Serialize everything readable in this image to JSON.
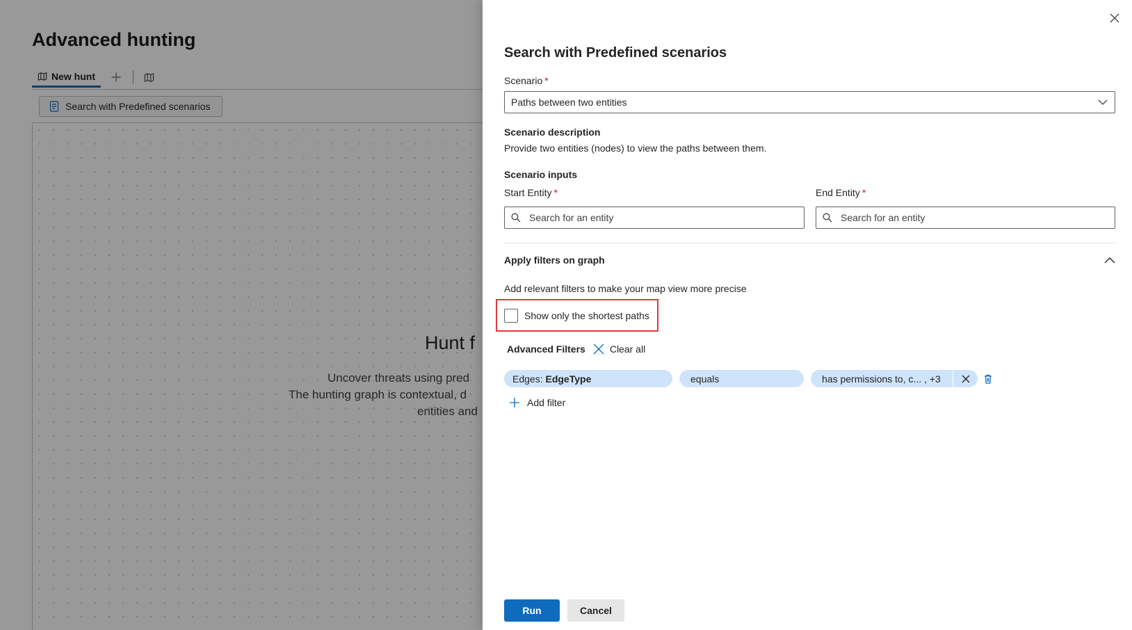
{
  "background": {
    "page_title": "Advanced hunting",
    "tabs": [
      {
        "label": "New hunt"
      }
    ],
    "toolbar": {
      "predefined_button": "Search with Predefined scenarios"
    },
    "empty_state": {
      "title": "Hunt f",
      "lines": [
        "Uncover threats using pred",
        "The hunting graph is contextual, d",
        "entities and"
      ]
    }
  },
  "panel": {
    "title": "Search with Predefined scenarios",
    "scenario": {
      "label": "Scenario",
      "required": "*",
      "value": "Paths between two entities"
    },
    "description": {
      "label": "Scenario description",
      "text": "Provide two entities (nodes) to view the paths between them."
    },
    "inputs": {
      "label": "Scenario inputs",
      "start": {
        "label": "Start Entity",
        "required": "*",
        "placeholder": "Search for an entity"
      },
      "end": {
        "label": "End Entity",
        "required": "*",
        "placeholder": "Search for an entity"
      }
    },
    "filters": {
      "title": "Apply filters on graph",
      "hint": "Add relevant filters to make your map view more precise",
      "shortest_paths_label": "Show only the shortest paths",
      "shortest_paths_checked": false,
      "advanced_title": "Advanced Filters",
      "clear_all": "Clear all",
      "rule": {
        "field_prefix": "Edges:",
        "field_name": "EdgeType",
        "operator": "equals",
        "value": "has permissions to, c...",
        "more": ", +3"
      },
      "add_filter": "Add filter"
    },
    "actions": {
      "run": "Run",
      "cancel": "Cancel"
    }
  },
  "colors": {
    "accent": "#0f6cbd",
    "pill": "#cfe4fa",
    "highlight": "#e0393e",
    "required": "#c50f1f"
  }
}
